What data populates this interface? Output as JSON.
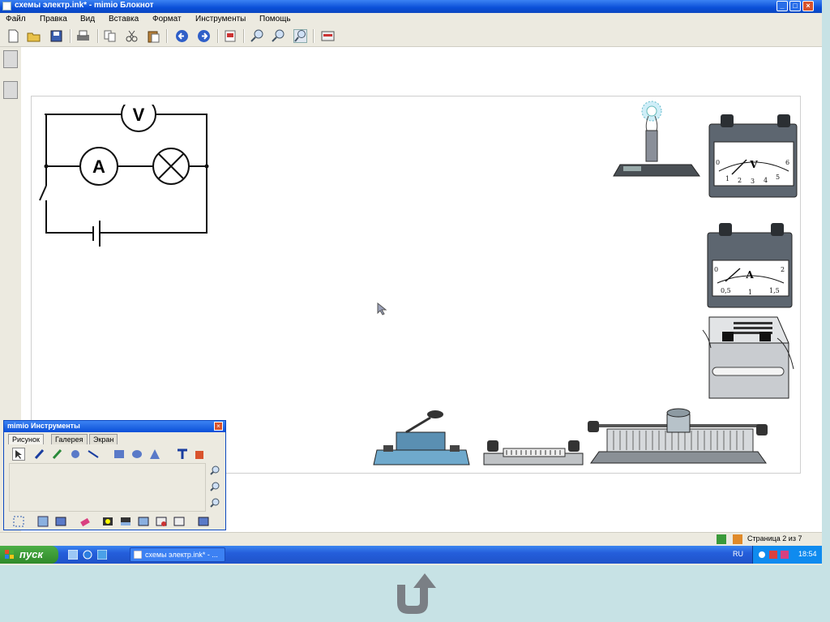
{
  "window": {
    "title": "схемы электр.ink* - mimio Блокнот",
    "controls": {
      "minimize": "_",
      "maximize": "□",
      "close": "×"
    }
  },
  "menu": [
    "Файл",
    "Правка",
    "Вид",
    "Вставка",
    "Формат",
    "Инструменты",
    "Помощь"
  ],
  "toolbar_icons": [
    "new-icon",
    "open-icon",
    "save-icon",
    "print-icon",
    "copy-icon",
    "cut-icon",
    "paste-icon",
    "back-icon",
    "forward-icon",
    "insert-page-icon",
    "zoom-in-icon",
    "zoom-out-icon",
    "zoom-fit-icon",
    "fullscreen-icon"
  ],
  "circuit": {
    "voltmeter": "V",
    "ammeter": "A"
  },
  "instruments": {
    "voltmeter_label": "V",
    "voltmeter_scale": [
      "0",
      "1",
      "2",
      "3",
      "4",
      "5",
      "6"
    ],
    "ammeter_label": "A",
    "ammeter_scale": [
      "0",
      "0,5",
      "1",
      "1,5",
      "2"
    ]
  },
  "status": {
    "page_info": "Страница 2 из 7"
  },
  "taskbar": {
    "start_label": "пуск",
    "task_label": "схемы электр.ink* - ...",
    "language": "RU",
    "clock": "18:54"
  },
  "tools_window": {
    "title": "mimio Инструменты",
    "close": "×",
    "tabs": [
      "Рисунок",
      "Галерея",
      "Экран"
    ]
  }
}
